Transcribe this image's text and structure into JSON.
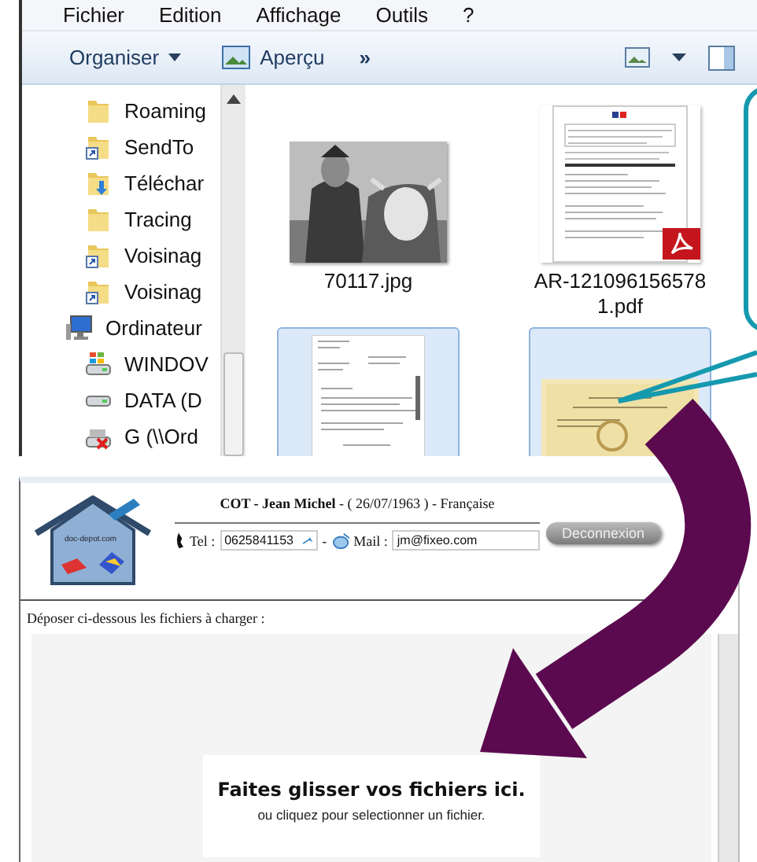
{
  "explorer": {
    "menu": [
      {
        "label": "Fichier"
      },
      {
        "label": "Edition"
      },
      {
        "label": "Affichage"
      },
      {
        "label": "Outils"
      },
      {
        "label": "?"
      }
    ],
    "toolbar": {
      "organize": "Organiser",
      "preview": "Aperçu",
      "more": "»"
    },
    "nav": [
      {
        "label": "Roaming",
        "kind": "folder"
      },
      {
        "label": "SendTo",
        "kind": "shortcut"
      },
      {
        "label": "Téléchar",
        "kind": "download"
      },
      {
        "label": "Tracing",
        "kind": "folder"
      },
      {
        "label": "Voisinag",
        "kind": "shortcut"
      },
      {
        "label": "Voisinag",
        "kind": "shortcut"
      },
      {
        "label": "Ordinateur",
        "kind": "computer",
        "children": [
          {
            "label": "WINDOV",
            "kind": "windows-drive"
          },
          {
            "label": "DATA (D",
            "kind": "drive"
          },
          {
            "label": "G (\\\\Ord",
            "kind": "network-drive"
          }
        ]
      }
    ],
    "files": [
      {
        "name": "70117.jpg",
        "selected": false
      },
      {
        "name": "AR-1210961565781.pdf",
        "kind": "pdf",
        "selected": false
      },
      {
        "kind": "document",
        "selected": true
      },
      {
        "kind": "diploma",
        "selected": true
      }
    ]
  },
  "web": {
    "identity": "**COT - Jean Michel** - ( 26/07/1963 ) - Française",
    "logout": "Deconnexion",
    "tel_label": "Tel :",
    "tel": "0625841153",
    "separator": "-",
    "mail_label": "Mail :",
    "mail": "jm@fixeo.com",
    "logo_text": "doc-depot.com",
    "instruction": "Déposer ci-dessous les fichiers à charger :",
    "drop_title": "Faites glisser vos fichiers ici.",
    "drop_hint": "ou cliquez pour selectionner un fichier."
  }
}
